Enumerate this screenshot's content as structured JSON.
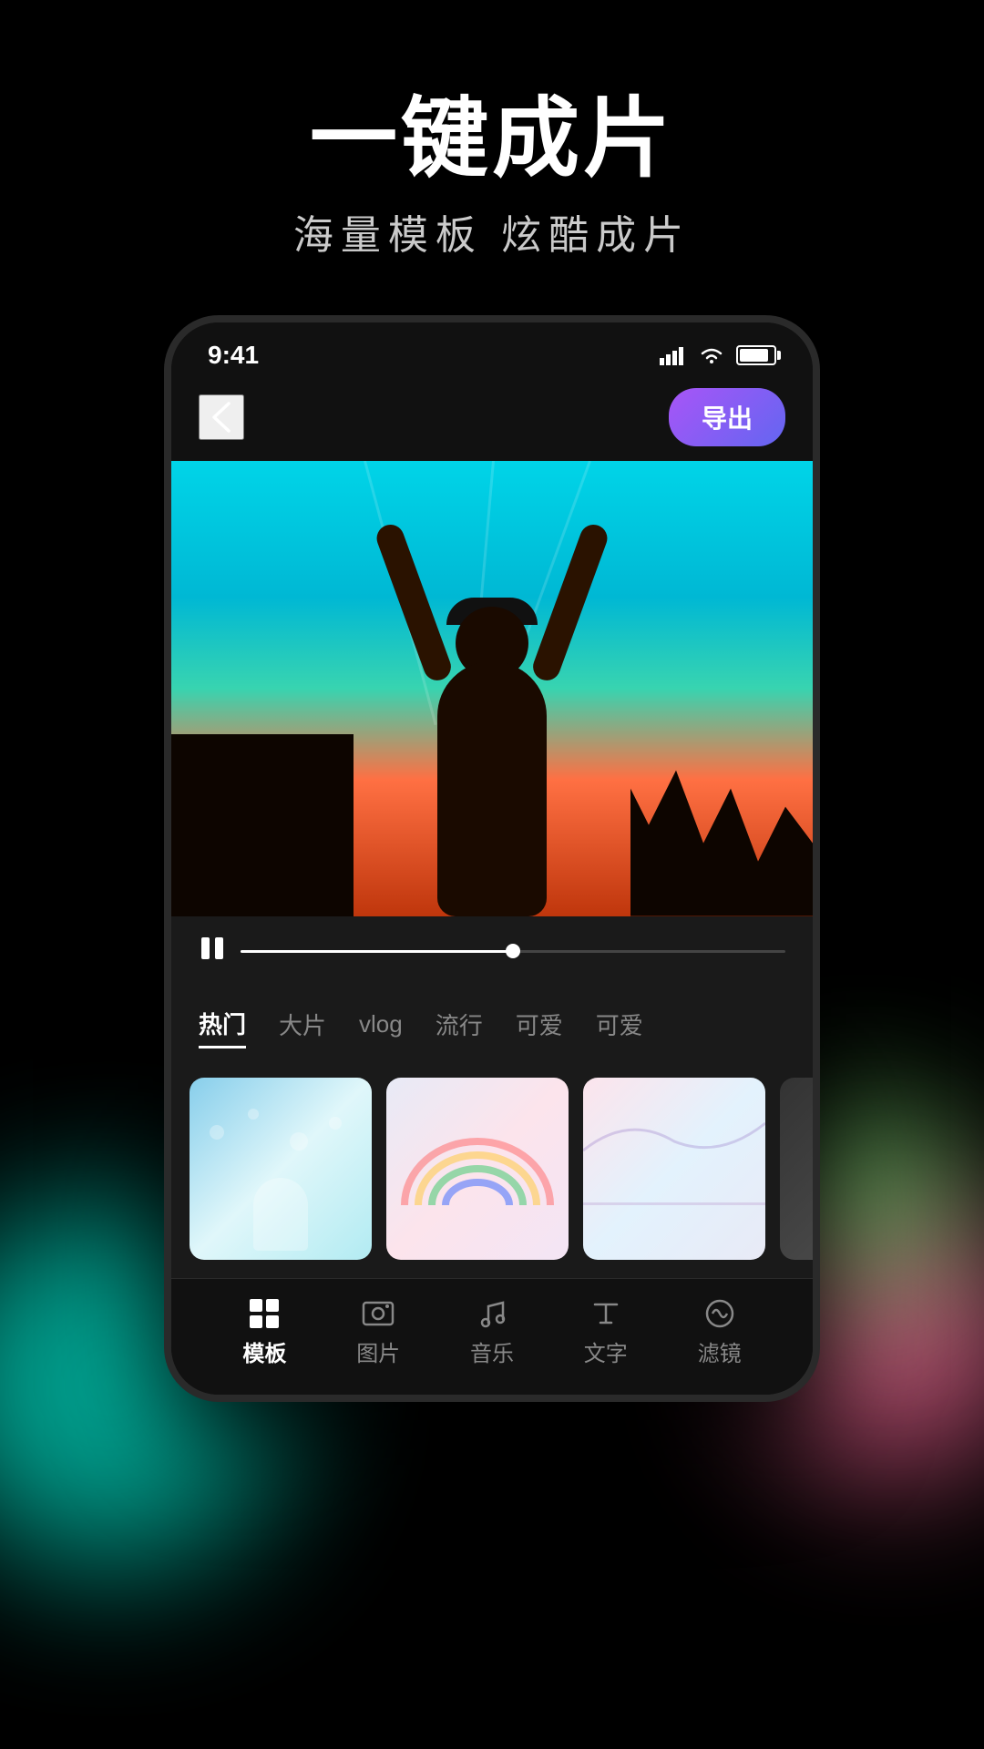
{
  "page": {
    "background": "#000000"
  },
  "header": {
    "main_title": "一键成片",
    "sub_title": "海量模板   炫酷成片"
  },
  "phone": {
    "status_bar": {
      "time": "9:41"
    },
    "top_bar": {
      "back_label": "‹",
      "export_label": "导出"
    },
    "category_tabs": [
      {
        "label": "热门",
        "active": true
      },
      {
        "label": "大片",
        "active": false
      },
      {
        "label": "vlog",
        "active": false
      },
      {
        "label": "流行",
        "active": false
      },
      {
        "label": "可爱",
        "active": false
      },
      {
        "label": "可爱",
        "active": false
      }
    ],
    "bottom_nav": [
      {
        "label": "模板",
        "active": true
      },
      {
        "label": "图片",
        "active": false
      },
      {
        "label": "音乐",
        "active": false
      },
      {
        "label": "文字",
        "active": false
      },
      {
        "label": "滤镜",
        "active": false
      }
    ]
  }
}
